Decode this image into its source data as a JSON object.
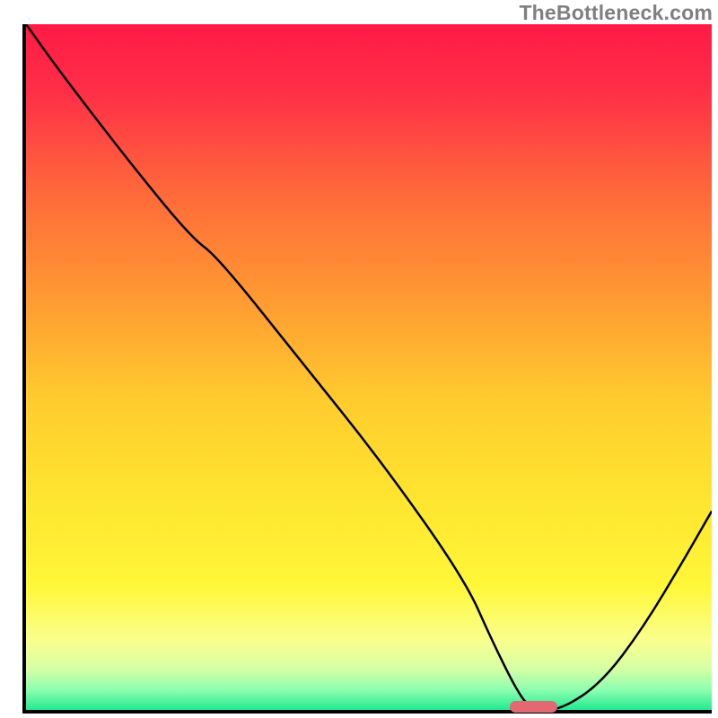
{
  "watermark": "TheBottleneck.com",
  "chart_data": {
    "type": "line",
    "title": "",
    "xlabel": "",
    "ylabel": "",
    "xlim": [
      0,
      100
    ],
    "ylim": [
      0,
      100
    ],
    "series": [
      {
        "name": "bottleneck-curve",
        "x": [
          0,
          5,
          15,
          24,
          28,
          40,
          52,
          64,
          68,
          72,
          74,
          78,
          84,
          90,
          96,
          100
        ],
        "y": [
          100,
          93,
          80,
          69,
          66,
          51,
          36,
          19,
          10,
          2,
          0,
          0,
          4,
          12,
          22,
          29
        ]
      }
    ],
    "gradient_stops": [
      {
        "offset": 0.0,
        "color": "#ff1a46"
      },
      {
        "offset": 0.1,
        "color": "#ff2f47"
      },
      {
        "offset": 0.25,
        "color": "#ff6b3a"
      },
      {
        "offset": 0.4,
        "color": "#ff9a32"
      },
      {
        "offset": 0.55,
        "color": "#ffcc2e"
      },
      {
        "offset": 0.7,
        "color": "#ffe62f"
      },
      {
        "offset": 0.82,
        "color": "#fff739"
      },
      {
        "offset": 0.9,
        "color": "#f9ff8e"
      },
      {
        "offset": 0.94,
        "color": "#d6ffa5"
      },
      {
        "offset": 0.97,
        "color": "#8fffb0"
      },
      {
        "offset": 1.0,
        "color": "#23e993"
      }
    ],
    "marker": {
      "name": "sweet-spot-marker",
      "x_start": 70.5,
      "x_end": 77.5,
      "y": 0.5,
      "height_pct": 1.7
    }
  }
}
